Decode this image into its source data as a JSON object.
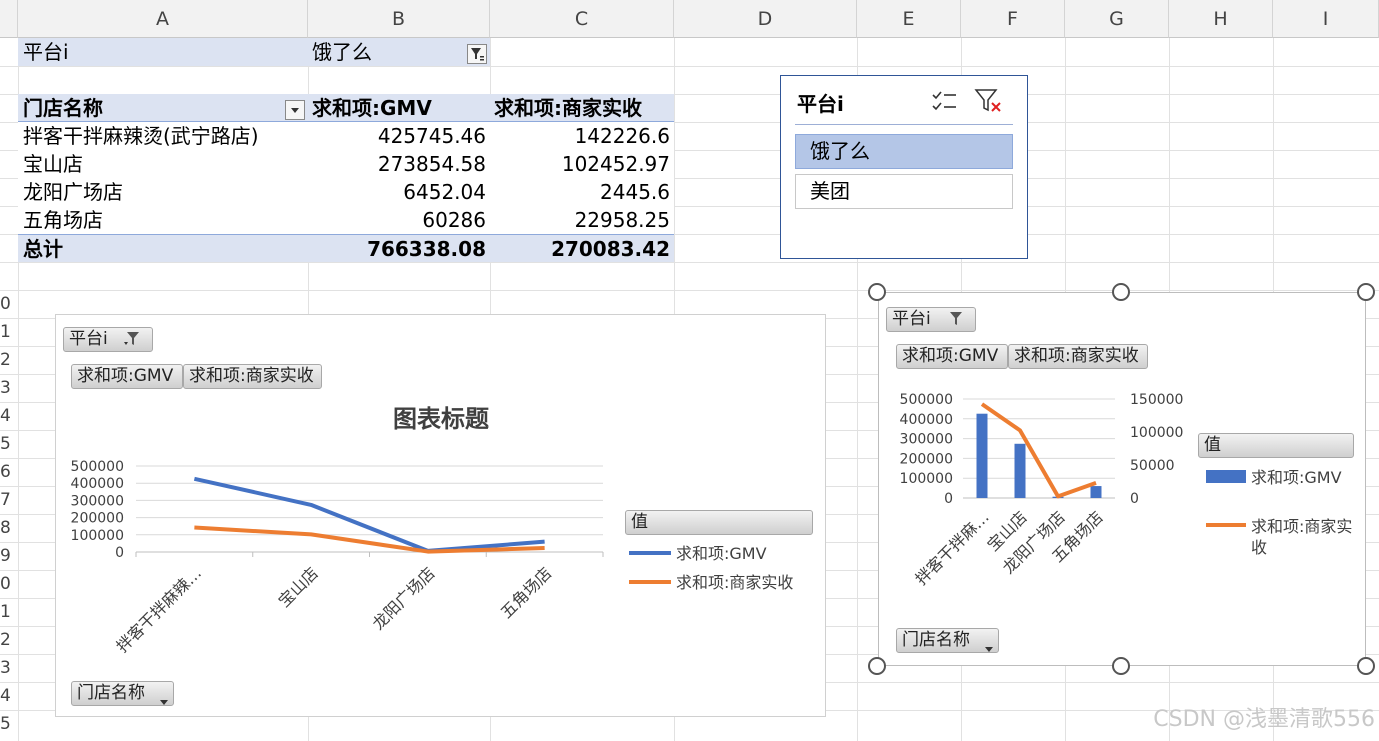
{
  "columns": [
    "A",
    "B",
    "C",
    "D",
    "E",
    "F",
    "G",
    "H",
    "I"
  ],
  "row_labels": [
    "0",
    "1",
    "2",
    "3",
    "4",
    "5",
    "6",
    "7",
    "8",
    "9",
    "0",
    "1",
    "2",
    "3",
    "4",
    "5"
  ],
  "pivot": {
    "filter_label": "平台i",
    "filter_value": "饿了么",
    "headers": [
      "门店名称",
      "求和项:GMV",
      "求和项:商家实收"
    ],
    "rows": [
      {
        "name": "拌客干拌麻辣烫(武宁路店)",
        "gmv": "425745.46",
        "income": "142226.6"
      },
      {
        "name": "宝山店",
        "gmv": "273854.58",
        "income": "102452.97"
      },
      {
        "name": "龙阳广场店",
        "gmv": "6452.04",
        "income": "2445.6"
      },
      {
        "name": "五角场店",
        "gmv": "60286",
        "income": "22958.25"
      }
    ],
    "total": {
      "name": "总计",
      "gmv": "766338.08",
      "income": "270083.42"
    }
  },
  "slicer": {
    "title": "平台i",
    "items": [
      {
        "label": "饿了么",
        "selected": true
      },
      {
        "label": "美团",
        "selected": false
      }
    ],
    "multiselect_icon": "multi-select-icon",
    "clear_icon": "clear-filter-icon"
  },
  "chart1_buttons": {
    "filter": "平台i",
    "gmv": "求和项:GMV",
    "income": "求和项:商家实收",
    "axis": "门店名称",
    "legend_title": "值"
  },
  "chart2_buttons": {
    "filter": "平台i",
    "gmv": "求和项:GMV",
    "income": "求和项:商家实收",
    "axis": "门店名称",
    "legend_title": "值"
  },
  "chart_data": [
    {
      "type": "line",
      "title": "图表标题",
      "categories": [
        "拌客干拌麻辣…",
        "宝山店",
        "龙阳广场店",
        "五角场店"
      ],
      "series": [
        {
          "name": "求和项:GMV",
          "values": [
            425745.46,
            273854.58,
            6452.04,
            60286
          ],
          "color": "#4472c4"
        },
        {
          "name": "求和项:商家实收",
          "values": [
            142226.6,
            102452.97,
            2445.6,
            22958.25
          ],
          "color": "#ed7d31"
        }
      ],
      "ylim": [
        0,
        500000
      ],
      "yticks": [
        "500000",
        "400000",
        "300000",
        "200000",
        "100000",
        "0"
      ],
      "legend_title": "值",
      "legend": "right",
      "grid": true
    },
    {
      "type": "bar",
      "categories": [
        "拌客干拌麻…",
        "宝山店",
        "龙阳广场店",
        "五角场店"
      ],
      "series": [
        {
          "name": "求和项:GMV",
          "chart": "bar",
          "axis": "primary",
          "values": [
            425745.46,
            273854.58,
            6452.04,
            60286
          ],
          "color": "#4472c4"
        },
        {
          "name": "求和项:商家实收",
          "chart": "line",
          "axis": "secondary",
          "values": [
            142226.6,
            102452.97,
            2445.6,
            22958.25
          ],
          "color": "#ed7d31"
        }
      ],
      "ylim": [
        0,
        500000
      ],
      "y2lim": [
        0,
        150000
      ],
      "yticks": [
        "500000",
        "400000",
        "300000",
        "200000",
        "100000",
        "0"
      ],
      "y2ticks": [
        "150000",
        "100000",
        "50000",
        "0"
      ],
      "legend_title": "值",
      "legend": "right",
      "grid": true
    }
  ],
  "colors": {
    "accent": "#4472c4",
    "orange": "#ed7d31",
    "pivot_header": "#dce3f2",
    "slicer_selected": "#b4c6e7"
  },
  "watermark": "CSDN @浅墨清歌556"
}
